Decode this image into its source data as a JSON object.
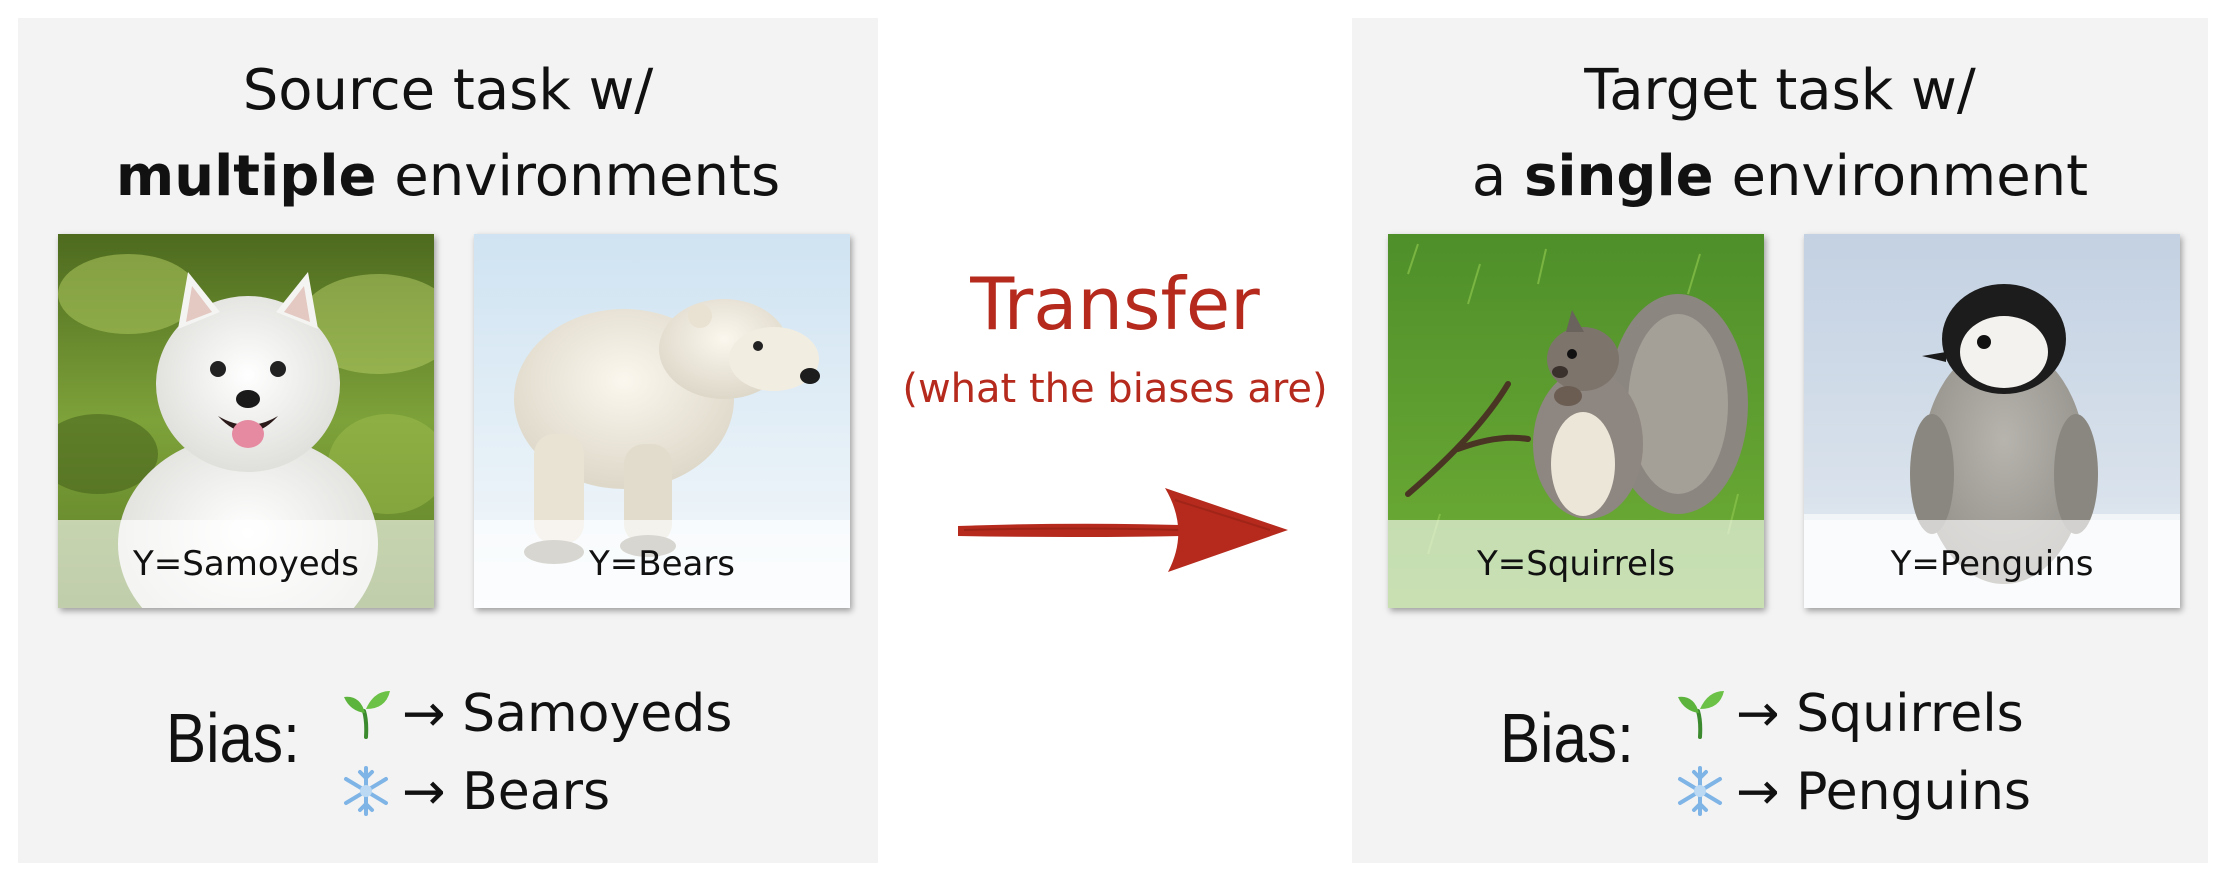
{
  "source_panel": {
    "title_line1": "Source task w/",
    "title_bold": "multiple",
    "title_rest": " environments",
    "images": [
      {
        "caption": "Y=Samoyeds",
        "depicts": "samoyed dog on grass"
      },
      {
        "caption": "Y=Bears",
        "depicts": "polar bear on snow"
      }
    ],
    "bias_label": "Bias:",
    "bias_rows": [
      {
        "icon": "seedling-icon",
        "text": "→ Samoyeds"
      },
      {
        "icon": "snowflake-icon",
        "text": "→ Bears"
      }
    ]
  },
  "transfer": {
    "title": "Transfer",
    "subtitle": "(what the biases are)",
    "color": "#b52a1d"
  },
  "target_panel": {
    "title_line1": "Target task w/",
    "title_prefix": "a ",
    "title_bold": "single",
    "title_rest": " environment",
    "images": [
      {
        "caption": "Y=Squirrels",
        "depicts": "squirrel on grass"
      },
      {
        "caption": "Y=Penguins",
        "depicts": "penguin chick on snow"
      }
    ],
    "bias_label": "Bias:",
    "bias_rows": [
      {
        "icon": "seedling-icon",
        "text": "→ Squirrels"
      },
      {
        "icon": "snowflake-icon",
        "text": "→ Penguins"
      }
    ]
  }
}
